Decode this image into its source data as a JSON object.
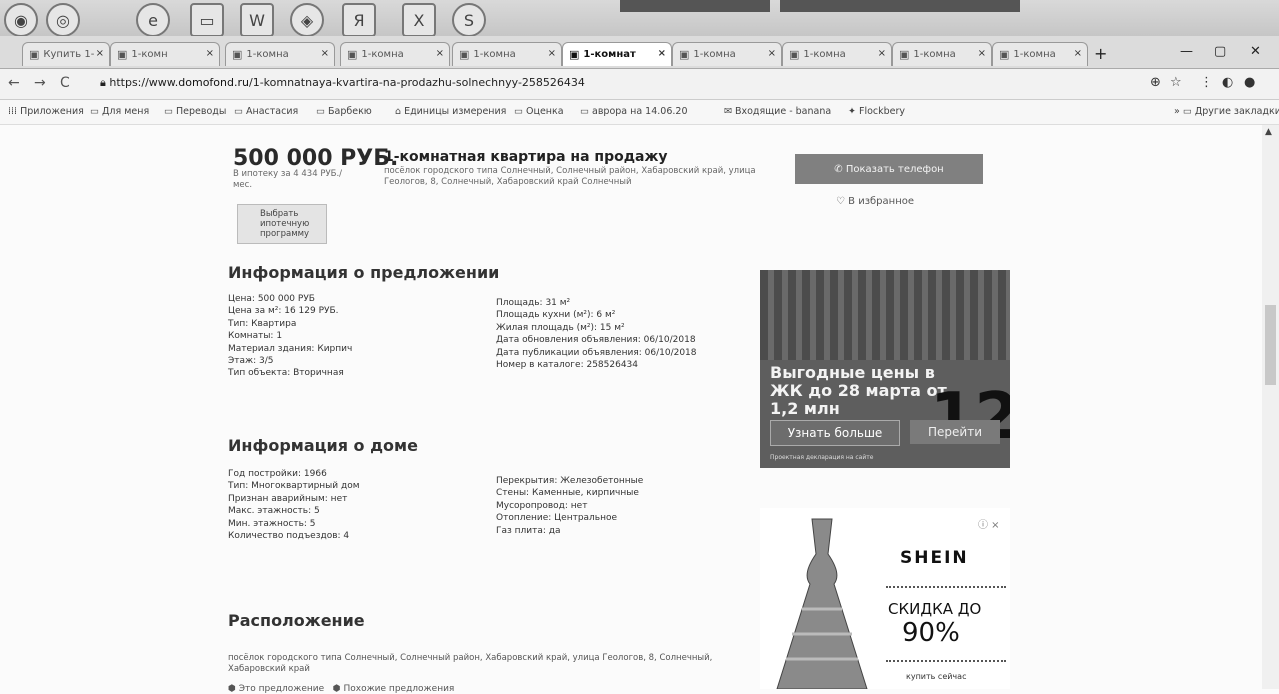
{
  "taskbar": {
    "apps": [
      {
        "icon": "chrome-icon",
        "glyph": "◉"
      },
      {
        "icon": "chrome-alt-icon",
        "glyph": "◎"
      },
      {
        "icon": "ie-icon",
        "glyph": "e"
      },
      {
        "icon": "folder-icon",
        "glyph": "▭"
      },
      {
        "icon": "word-icon",
        "glyph": "W"
      },
      {
        "icon": "media-icon",
        "glyph": "◈"
      },
      {
        "icon": "yandex-icon",
        "glyph": "Я"
      },
      {
        "icon": "excel-icon",
        "glyph": "X"
      },
      {
        "icon": "skype-icon",
        "glyph": "S"
      }
    ]
  },
  "tabs": [
    {
      "label": "Купить 1-"
    },
    {
      "label": "1-комн"
    },
    {
      "label": "1-комна"
    },
    {
      "label": "1-комна"
    },
    {
      "label": "1-комна"
    },
    {
      "label": "1-комнат",
      "active": true
    },
    {
      "label": "1-комна"
    },
    {
      "label": "1-комна"
    },
    {
      "label": "1-комна"
    },
    {
      "label": "1-комна"
    }
  ],
  "address_bar": {
    "url_prefix": "https://www.",
    "url_host": "domofond.ru",
    "url_path": "/1-komnatnaya-kvartira-na-prodazhu-solnechnyy-258526434"
  },
  "bookmarks": [
    {
      "label": "Приложения",
      "icon": "apps-icon"
    },
    {
      "label": "Для меня",
      "icon": "folder-icon"
    },
    {
      "label": "Переводы",
      "icon": "folder-icon"
    },
    {
      "label": "Анастасия",
      "icon": "folder-icon"
    },
    {
      "label": "Барбекю",
      "icon": "folder-icon"
    },
    {
      "label": "Единицы измерения",
      "icon": "bank-icon"
    },
    {
      "label": "Оценка",
      "icon": "folder-icon"
    },
    {
      "label": "аврора на 14.06.20",
      "icon": "folder-icon"
    },
    {
      "label": "Входящие - banana",
      "icon": "mail-icon"
    },
    {
      "label": "Flockbery",
      "icon": "bird-icon"
    }
  ],
  "bookmarks_other": "Другие закладки",
  "listing": {
    "price": "500 000 РУБ.",
    "mortgage": "В ипотеку за 4 434 РУБ./мес.",
    "choose_program": "Выбрать ипотечную программу",
    "title": "1-комнатная квартира на продажу",
    "address": "посёлок городского типа Солнечный, Солнечный район, Хабаровский край, улица Геологов, 8, Солнечный, Хабаровский край Солнечный",
    "contact_button": "Показать телефон",
    "favorites": "В избранное"
  },
  "offer_info": {
    "heading": "Информация о предложении",
    "left": [
      "Цена: 500 000 РУБ",
      "Цена за м²: 16 129 РУБ.",
      "Тип: Квартира",
      "Комнаты: 1",
      "Материал здания: Кирпич",
      "Этаж: 3/5",
      "Тип объекта: Вторичная"
    ],
    "right": [
      "Площадь: 31 м²",
      "Площадь кухни (м²): 6 м²",
      "Жилая площадь (м²): 15 м²",
      "Дата обновления объявления: 06/10/2018",
      "Дата публикации объявления: 06/10/2018",
      "Номер в каталоге: 258526434"
    ]
  },
  "house_info": {
    "heading": "Информация о доме",
    "left": [
      "Год постройки: 1966",
      "Тип: Многоквартирный дом",
      "Признан аварийным: нет",
      "Макс. этажность: 5",
      "Мин. этажность: 5",
      "Количество подъездов: 4"
    ],
    "right": [
      "Перекрытия: Железобетонные",
      "Стены: Каменные, кирпичные",
      "Мусоропровод: нет",
      "Отопление: Центральное",
      "Газ плита: да"
    ]
  },
  "location": {
    "heading": "Расположение",
    "text": "посёлок городского типа Солнечный, Солнечный район, Хабаровский край, улица Геологов, 8, Солнечный, Хабаровский край",
    "link1": "Это предложение",
    "link2": "Похожие предложения"
  },
  "ad_realty": {
    "promo": "Выгодные цены в ЖК до 28 марта от 1,2 млн",
    "big": "12",
    "more": "Узнать больше",
    "more2": "Перейти",
    "legal": "Проектная декларация на сайте"
  },
  "ad_shein": {
    "brand": "SHEIN",
    "discount_line1": "СКИДКА ДО",
    "discount_line2": "90%",
    "shop": "купить сейчас",
    "close": "ⓘ ×"
  }
}
